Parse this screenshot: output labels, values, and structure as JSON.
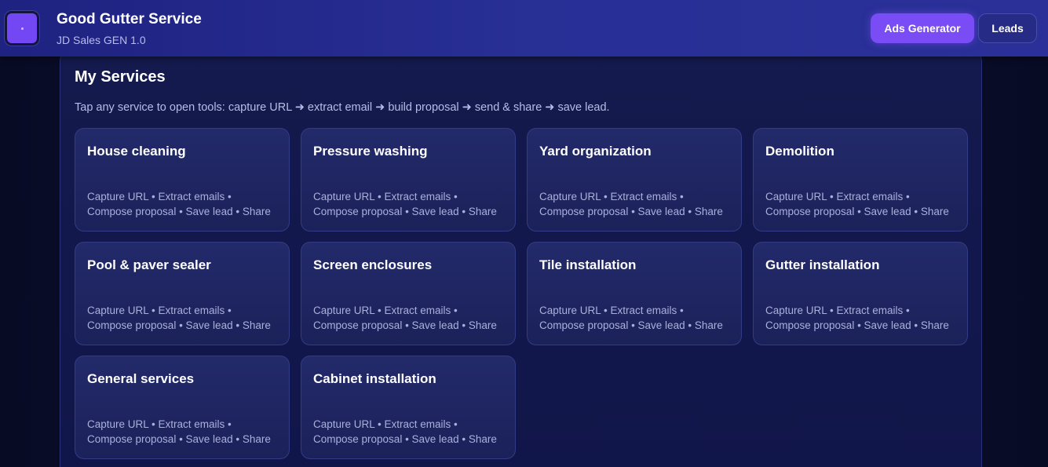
{
  "header": {
    "title": "Good Gutter Service",
    "subtitle": "JD Sales GEN 1.0",
    "ads_button": "Ads Generator",
    "leads_button": "Leads"
  },
  "panel": {
    "title": "My Services",
    "description": "Tap any service to open tools: capture URL ➜ extract email ➜ build proposal ➜ send & share ➜ save lead."
  },
  "services": [
    {
      "name": "House cleaning",
      "line1": "Capture URL • Extract emails •",
      "line2": "Compose proposal • Save lead • Share"
    },
    {
      "name": "Pressure washing",
      "line1": "Capture URL • Extract emails •",
      "line2": "Compose proposal • Save lead • Share"
    },
    {
      "name": "Yard organization",
      "line1": "Capture URL • Extract emails •",
      "line2": "Compose proposal • Save lead • Share"
    },
    {
      "name": "Demolition",
      "line1": "Capture URL • Extract emails •",
      "line2": "Compose proposal • Save lead • Share"
    },
    {
      "name": "Pool & paver sealer",
      "line1": "Capture URL • Extract emails •",
      "line2": "Compose proposal • Save lead • Share"
    },
    {
      "name": "Screen enclosures",
      "line1": "Capture URL • Extract emails •",
      "line2": "Compose proposal • Save lead • Share"
    },
    {
      "name": "Tile installation",
      "line1": "Capture URL • Extract emails •",
      "line2": "Compose proposal • Save lead • Share"
    },
    {
      "name": "Gutter installation",
      "line1": "Capture URL • Extract emails •",
      "line2": "Compose proposal • Save lead • Share"
    },
    {
      "name": "General services",
      "line1": "Capture URL • Extract emails •",
      "line2": "Compose proposal • Save lead • Share"
    },
    {
      "name": "Cabinet installation",
      "line1": "Capture URL • Extract emails •",
      "line2": "Compose proposal • Save lead • Share"
    }
  ],
  "colors": {
    "accent": "#7a4cf6",
    "header_bg": "#282f95",
    "page_bg": "#0b0e2a"
  }
}
